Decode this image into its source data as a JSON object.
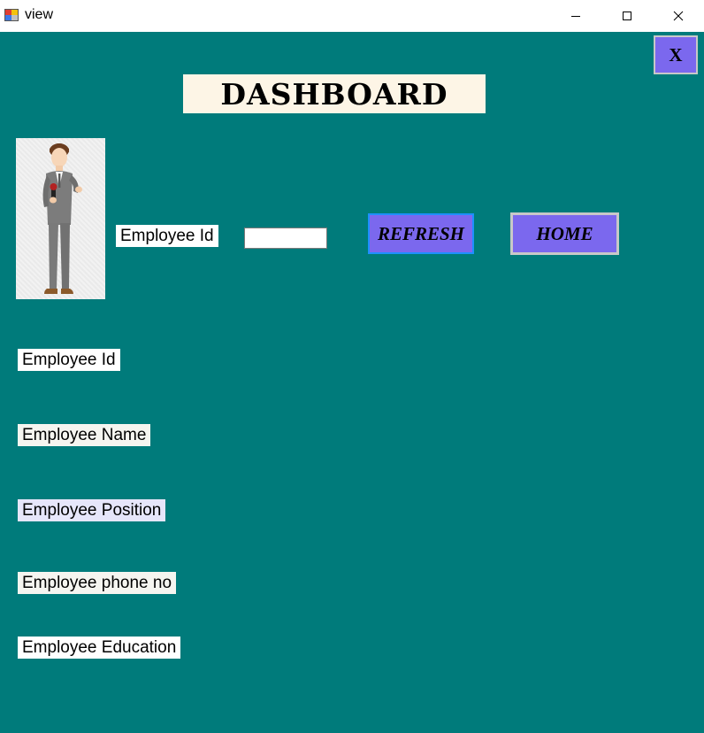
{
  "window": {
    "title": "view",
    "minimize_glyph": "─",
    "close_glyph": "✕"
  },
  "form": {
    "close_label": "X",
    "heading": "DASHBOARD",
    "avatar_icon": "employee-avatar-icon",
    "search": {
      "label": "Employee Id",
      "value": "",
      "refresh_label": "REFRESH",
      "home_label": "HOME"
    },
    "fields": [
      {
        "label": "Employee Id"
      },
      {
        "label": "Employee Name"
      },
      {
        "label": "Employee Position"
      },
      {
        "label": "Employee phone no"
      },
      {
        "label": "Employee Education"
      }
    ]
  },
  "colors": {
    "background": "#007b7b",
    "button": "#7b68ee",
    "heading_bg": "#fdf5e6"
  }
}
